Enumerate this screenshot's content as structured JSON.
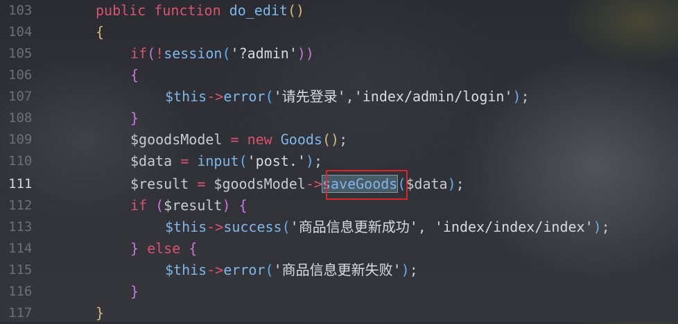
{
  "gutter": {
    "line_numbers": [
      "103",
      "104",
      "105",
      "106",
      "107",
      "108",
      "109",
      "110",
      "111",
      "112",
      "113",
      "114",
      "115",
      "116",
      "117"
    ],
    "current_line": "111"
  },
  "code": {
    "l103": {
      "a": "public ",
      "b": "function ",
      "c": "do_edit",
      "d": "()"
    },
    "l104": {
      "a": "{"
    },
    "l105": {
      "a": "if",
      "b": "(",
      "c": "!",
      "d": "session",
      "e": "(",
      "f": "'?admin'",
      "g": "))"
    },
    "l106": {
      "a": "{"
    },
    "l107": {
      "a": "$this",
      "b": "->",
      "c": "error",
      "d": "(",
      "e": "'请先登录'",
      "f": ",",
      "g": "'index/admin/login'",
      "h": ")",
      "i": ";"
    },
    "l108": {
      "a": "}"
    },
    "l109": {
      "a": "$goodsModel",
      "b": " = ",
      "c": "new ",
      "d": "Goods",
      "e": "()",
      "f": ";"
    },
    "l110": {
      "a": "$data",
      "b": " = ",
      "c": "input",
      "d": "(",
      "e": "'post.'",
      "f": ")",
      "g": ";"
    },
    "l111": {
      "a": "$result",
      "b": " = ",
      "c": "$goodsModel",
      "d": "->",
      "e": "saveGoods",
      "f": "(",
      "g": "$data",
      "h": ")",
      "i": ";"
    },
    "l112": {
      "a": "if ",
      "b": "(",
      "c": "$result",
      "d": ") ",
      "e": "{"
    },
    "l113": {
      "a": "$this",
      "b": "->",
      "c": "success",
      "d": "(",
      "e": "'商品信息更新成功'",
      "f": ", ",
      "g": "'index/index/index'",
      "h": ")",
      "i": ";"
    },
    "l114": {
      "a": "} ",
      "b": "else ",
      "c": "{"
    },
    "l115": {
      "a": "$this",
      "b": "->",
      "c": "error",
      "d": "(",
      "e": "'商品信息更新失败'",
      "f": ")",
      "g": ";"
    },
    "l116": {
      "a": "}"
    },
    "l117": {
      "a": "}"
    }
  },
  "colors": {
    "keyword": "#d9536f",
    "function": "#7fb7ea",
    "highlight_box": "#d8262a"
  }
}
